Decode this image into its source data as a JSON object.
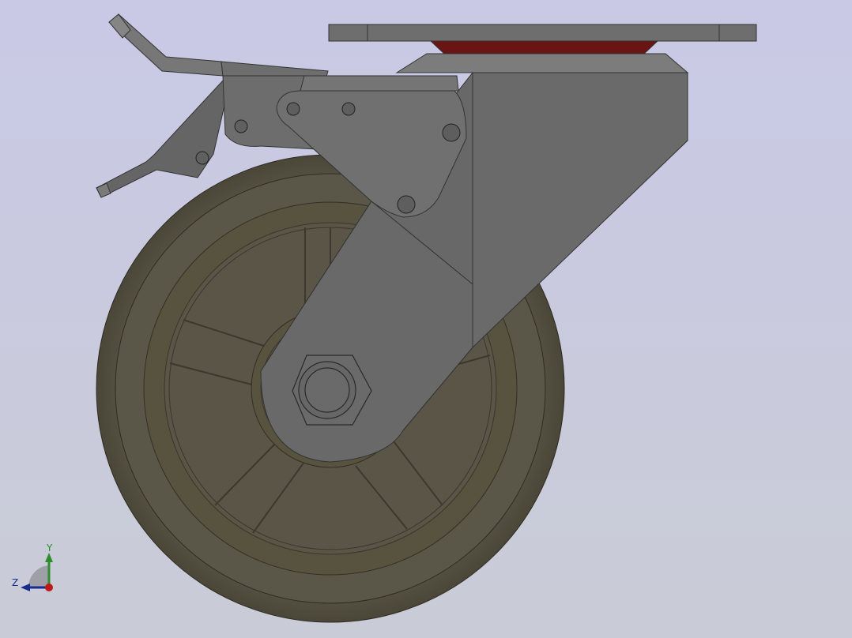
{
  "viewport": {
    "background_top": "#c9c9e6",
    "background_bottom": "#c9ccd6",
    "model": "swivel-caster-with-brake"
  },
  "colors": {
    "wheel_tread": "#5a5648",
    "wheel_edge": "#3e3a30",
    "bracket": "#6a6a6a",
    "bracket_dark": "#555555",
    "top_plate": "#6e6e6e",
    "bearing_red": "#7a1a1a"
  },
  "triad": {
    "y_label": "Y",
    "z_label": "Z",
    "y_color": "#2e8b2e",
    "z_color": "#1a2a8c",
    "x_color": "#c01818"
  }
}
